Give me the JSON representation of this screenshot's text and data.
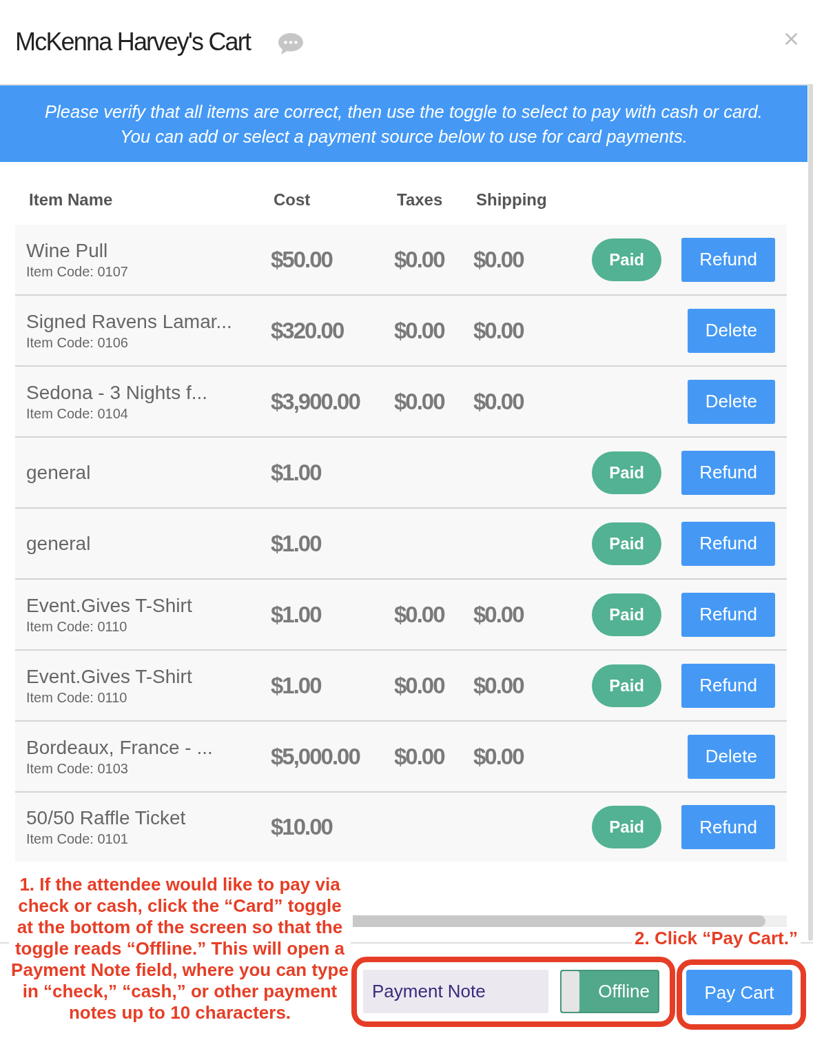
{
  "dialog": {
    "title": "McKenna Harvey's Cart"
  },
  "banner": {
    "lines": [
      "Please verify that all items are correct, then use the toggle to select to pay with cash or card.",
      "You can add or select a payment source below to use for card payments."
    ]
  },
  "table": {
    "columns": [
      "Item Name",
      "Cost",
      "Taxes",
      "Shipping"
    ],
    "rows": [
      {
        "name": "Wine Pull",
        "code": "Item Code: 0107",
        "cost": "$50.00",
        "taxes": "$0.00",
        "shipping": "$0.00",
        "badge": "Paid",
        "action": "Refund"
      },
      {
        "name": "Signed Ravens Lamar...",
        "code": "Item Code: 0106",
        "cost": "$320.00",
        "taxes": "$0.00",
        "shipping": "$0.00",
        "action": "Delete"
      },
      {
        "name": "Sedona - 3 Nights f...",
        "code": "Item Code: 0104",
        "cost": "$3,900.00",
        "taxes": "$0.00",
        "shipping": "$0.00",
        "action": "Delete"
      },
      {
        "name": "general",
        "cost": "$1.00",
        "badge": "Paid",
        "action": "Refund"
      },
      {
        "name": "general",
        "cost": "$1.00",
        "badge": "Paid",
        "action": "Refund"
      },
      {
        "name": "Event.Gives T-Shirt",
        "code": "Item Code: 0110",
        "cost": "$1.00",
        "taxes": "$0.00",
        "shipping": "$0.00",
        "badge": "Paid",
        "action": "Refund"
      },
      {
        "name": "Event.Gives T-Shirt",
        "code": "Item Code: 0110",
        "cost": "$1.00",
        "taxes": "$0.00",
        "shipping": "$0.00",
        "badge": "Paid",
        "action": "Refund"
      },
      {
        "name": "Bordeaux, France - ...",
        "code": "Item Code: 0103",
        "cost": "$5,000.00",
        "taxes": "$0.00",
        "shipping": "$0.00",
        "action": "Delete"
      },
      {
        "name": "50/50 Raffle Ticket",
        "code": "Item Code: 0101",
        "cost": "$10.00",
        "badge": "Paid",
        "action": "Refund"
      }
    ]
  },
  "footer": {
    "note_field": {
      "placeholder": "Payment Note"
    },
    "toggle": {
      "label": "Offline",
      "checked": true
    },
    "pay_button": "Pay Cart"
  },
  "callouts": [
    {
      "text": "1. If the attendee would like to pay via check or cash, click the “Card” toggle at the bottom of the screen so that the toggle reads “Offline.” This will open a Payment Note field, where you can type in “check,” “cash,” or other payment notes up to 10 characters."
    },
    {
      "text": "2. Click “Pay Cart.”"
    }
  ]
}
